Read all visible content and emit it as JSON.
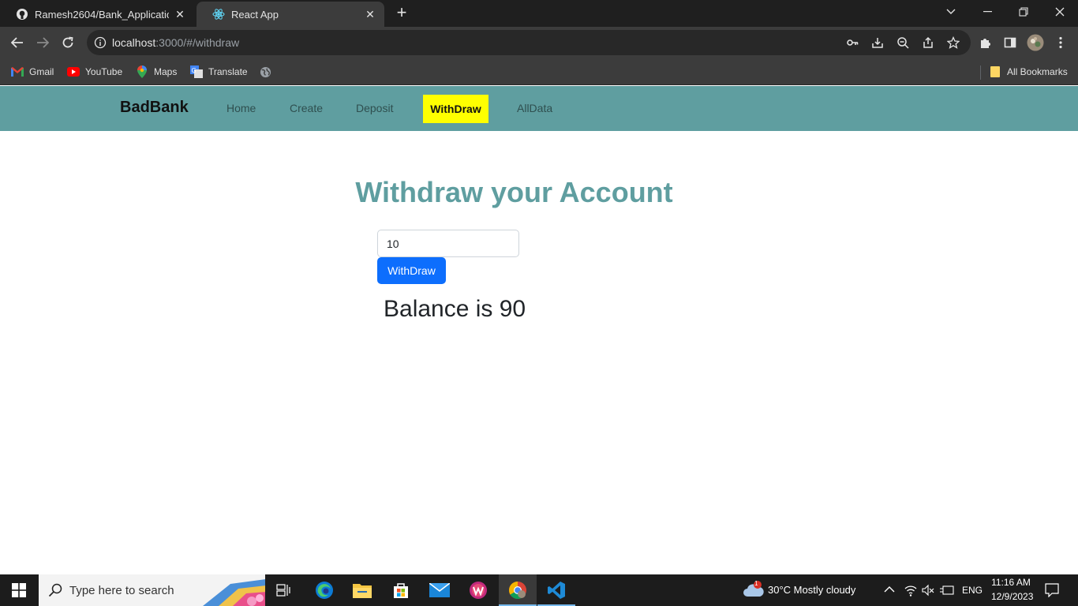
{
  "browser": {
    "tabs": [
      {
        "title": "Ramesh2604/Bank_Application_",
        "active": false,
        "favicon": "github-icon"
      },
      {
        "title": "React App",
        "active": true,
        "favicon": "react-icon"
      }
    ],
    "url": {
      "host": "localhost",
      "rest": ":3000/#/withdraw"
    },
    "bookmarks": [
      {
        "label": "Gmail",
        "icon": "gmail-icon"
      },
      {
        "label": "YouTube",
        "icon": "youtube-icon"
      },
      {
        "label": "Maps",
        "icon": "maps-icon"
      },
      {
        "label": "Translate",
        "icon": "translate-icon"
      }
    ],
    "all_bookmarks": "All Bookmarks"
  },
  "navbar": {
    "brand": "BadBank",
    "links": [
      "Home",
      "Create",
      "Deposit",
      "WithDraw",
      "AllData"
    ],
    "active": "WithDraw",
    "colors": {
      "background": "#5f9ea0",
      "active_bg": "#ffff00"
    }
  },
  "main": {
    "heading": "Withdraw your Account",
    "amount_value": "10",
    "button_label": "WithDraw",
    "balance_text": "Balance is 90",
    "colors": {
      "heading": "#5f9ea0",
      "button": "#0d6efd"
    }
  },
  "taskbar": {
    "search_placeholder": "Type here to search",
    "weather": "30°C  Mostly cloudy",
    "weather_badge": "1",
    "language": "ENG",
    "time": "11:16 AM",
    "date": "12/9/2023"
  }
}
